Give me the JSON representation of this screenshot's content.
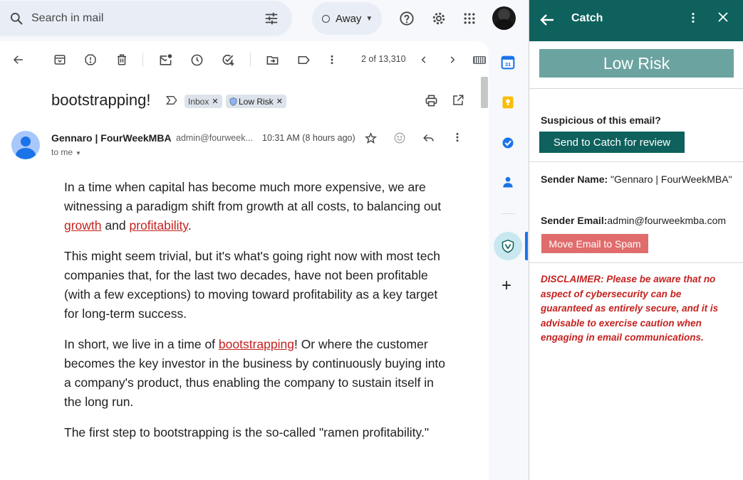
{
  "search": {
    "placeholder": "Search in mail"
  },
  "status": {
    "label": "Away"
  },
  "toolbar": {
    "page_count": "2 of 13,310"
  },
  "email": {
    "subject": "bootstrapping!",
    "labels": [
      {
        "text": "Inbox"
      },
      {
        "text": "Low Risk"
      }
    ],
    "sender_name": "Gennaro | FourWeekMBA",
    "sender_address": "admin@fourweek...",
    "recipient": "to me",
    "time": "10:31 AM (8 hours ago)",
    "paragraphs": [
      {
        "p1_a": "In a time when capital has become much more expensive, we are witnessing a paradigm shift from growth at all costs, to balancing out ",
        "link1": "growth",
        "p1_b": " and ",
        "link2": "profitability",
        "p1_c": "."
      },
      {
        "text": "This might seem trivial, but it's what's going right now with most tech companies that, for the last two decades, have not been profitable (with a few exceptions) to moving toward profitability as a key target for long-term success."
      },
      {
        "p3_a": "In short, we live in a time of ",
        "link": "bootstrapping",
        "p3_b": "! Or where the customer becomes the key investor in the business by continuously buying into a company's product, thus enabling the company to sustain itself in the long run."
      },
      {
        "text": "The first step to bootstrapping is the so-called \"ramen profitability.\""
      }
    ]
  },
  "catch_panel": {
    "title": "Catch",
    "risk_level": "Low Risk",
    "suspicious_prompt": "Suspicious of this email?",
    "review_button": "Send to Catch for review",
    "sender_name_label": "Sender Name:",
    "sender_name_value": " \"Gennaro | FourWeekMBA\"",
    "sender_email_label": "Sender Email:",
    "sender_email_value": "admin@fourweekmba.com",
    "spam_button": "Move Email to Spam",
    "disclaimer": "DISCLAIMER: Please be aware that no aspect of cybersecurity can be guaranteed as entirely secure, and it is advisable to exercise caution when engaging in email communications."
  },
  "colors": {
    "catch_header": "#0e615c",
    "risk_banner": "#6ba3a0",
    "spam_button": "#e06c6c",
    "disclaimer_text": "#c5221f",
    "link": "#c5221f"
  },
  "icons": [
    "search-icon",
    "tune-icon",
    "help-icon",
    "settings-icon",
    "apps-icon",
    "back-icon",
    "archive-icon",
    "report-spam-icon",
    "delete-icon",
    "mark-unread-icon",
    "snooze-icon",
    "add-task-icon",
    "move-to-icon",
    "label-icon",
    "more-icon",
    "prev-icon",
    "next-icon",
    "keyboard-icon",
    "print-icon",
    "open-new-window-icon",
    "star-icon",
    "emoji-icon",
    "reply-icon",
    "calendar-icon",
    "keep-icon",
    "tasks-icon",
    "contacts-icon",
    "catch-shield-icon",
    "add-icon",
    "close-icon"
  ]
}
